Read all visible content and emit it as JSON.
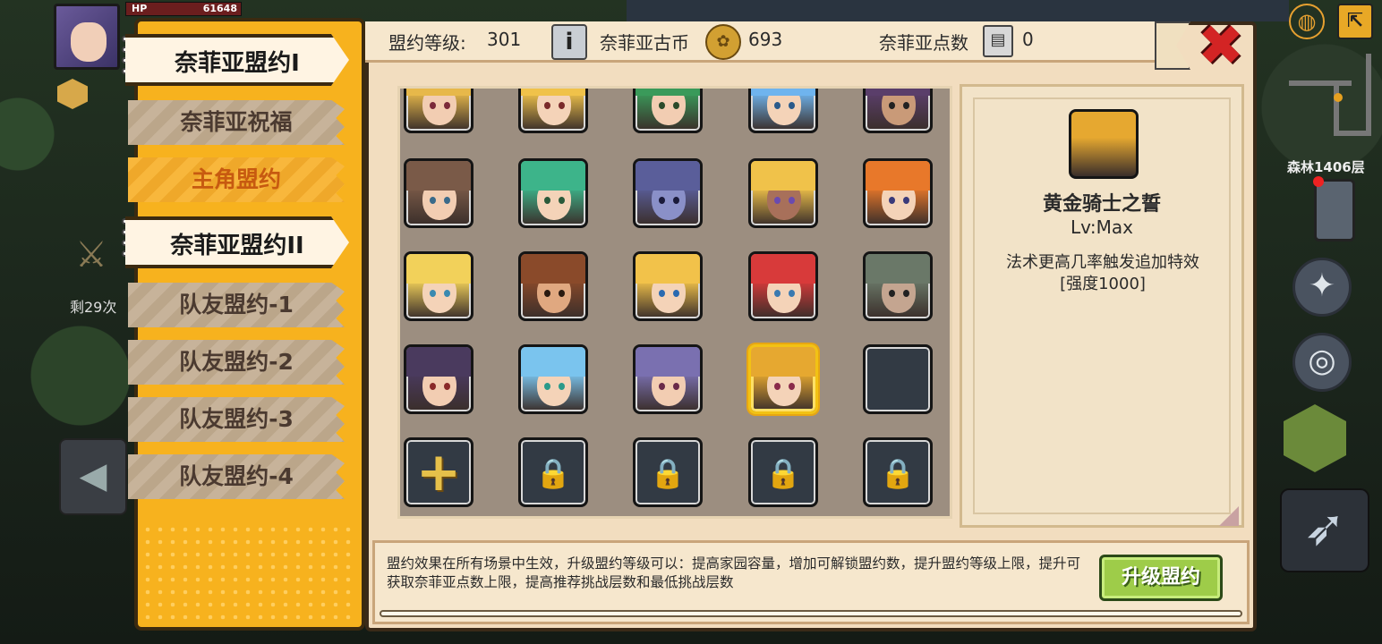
{
  "hud": {
    "hp_label": "HP",
    "hp_value": "61648",
    "left_count": "剩29次",
    "floor": "森林1406层"
  },
  "menu": {
    "items": [
      {
        "label": "奈菲亚盟约I",
        "style": "book"
      },
      {
        "label": "奈菲亚祝福",
        "style": "stone"
      },
      {
        "label": "主角盟约",
        "style": "active"
      },
      {
        "label": "奈菲亚盟约II",
        "style": "book"
      },
      {
        "label": "队友盟约-1",
        "style": "stone"
      },
      {
        "label": "队友盟约-2",
        "style": "stone"
      },
      {
        "label": "队友盟约-3",
        "style": "stone"
      },
      {
        "label": "队友盟约-4",
        "style": "stone"
      }
    ]
  },
  "header": {
    "level_label": "盟约等级:",
    "level_value": "301",
    "coin_label": "奈菲亚古币",
    "coin_value": "693",
    "points_label": "奈菲亚点数",
    "points_value": "0"
  },
  "grid": {
    "rows": [
      [
        {
          "hair": "#e7b84a",
          "skin": "#f2cdb2",
          "eye": "#7b2a3a"
        },
        {
          "hair": "#f0c24a",
          "skin": "#f4d3b8",
          "eye": "#7a2a2a"
        },
        {
          "hair": "#3a9a5a",
          "skin": "#f2cdb2",
          "eye": "#2a4a2a"
        },
        {
          "hair": "#6fb4ee",
          "skin": "#f4d3b8",
          "eye": "#2a5a8a"
        },
        {
          "hair": "#5a3e6a",
          "skin": "#c99a78",
          "eye": "#222222"
        }
      ],
      [
        {
          "hair": "#7a5a48",
          "skin": "#f2cdb2",
          "eye": "#3a6a8a"
        },
        {
          "hair": "#3db48a",
          "skin": "#f4d3b8",
          "eye": "#2a5a3a"
        },
        {
          "hair": "#5a5e9a",
          "skin": "#8a90c8",
          "eye": "#1a1a3a"
        },
        {
          "hair": "#f0c24a",
          "skin": "#a8705a",
          "eye": "#6a4ab0"
        },
        {
          "hair": "#e8782a",
          "skin": "#f4d3b8",
          "eye": "#3a3a7a"
        }
      ],
      [
        {
          "hair": "#f2d15a",
          "skin": "#f4d3b8",
          "eye": "#3a8ab0"
        },
        {
          "hair": "#8a4a2a",
          "skin": "#e0a880",
          "eye": "#2a1a10"
        },
        {
          "hair": "#f2c24a",
          "skin": "#f4d3b8",
          "eye": "#2a6ab0"
        },
        {
          "hair": "#d83a3a",
          "skin": "#f4d3b8",
          "eye": "#3a7ab0"
        },
        {
          "hair": "#6a7868",
          "skin": "#c4a590",
          "eye": "#222222"
        }
      ],
      [
        {
          "hair": "#4a3a5e",
          "skin": "#f2cdb2",
          "eye": "#8a2a2a"
        },
        {
          "hair": "#7ac4ee",
          "skin": "#f4d3b8",
          "eye": "#2a9a8a"
        },
        {
          "hair": "#7a70b0",
          "skin": "#f2cdb2",
          "eye": "#6a2a4a"
        },
        {
          "hair": "#e6a830",
          "skin": "#f4d3b8",
          "eye": "#8a2a4a",
          "selected": true
        },
        {
          "empty": true
        }
      ],
      [
        {
          "plus": true
        },
        {
          "locked": true
        },
        {
          "locked": true
        },
        {
          "locked": true
        },
        {
          "locked": true
        }
      ]
    ]
  },
  "detail": {
    "name": "黄金骑士之誓",
    "level": "Lv:Max",
    "description": "法术更高几率触发追加特效[强度1000]",
    "portrait": {
      "hair": "#e6a830",
      "skin": "#f4d3b8",
      "eye": "#8a2a4a"
    }
  },
  "footer": {
    "text": "盟约效果在所有场景中生效，升级盟约等级可以：提高家园容量，增加可解锁盟约数，提升盟约等级上限，提升可获取奈菲亚点数上限，提高推荐挑战层数和最低挑战层数",
    "upgrade_label": "升级盟约"
  },
  "icons": {
    "info": "info-icon",
    "coin": "coin-icon",
    "points": "chip-icon",
    "close": "close-icon",
    "lock": "lock-icon",
    "plus": "plus-icon"
  }
}
